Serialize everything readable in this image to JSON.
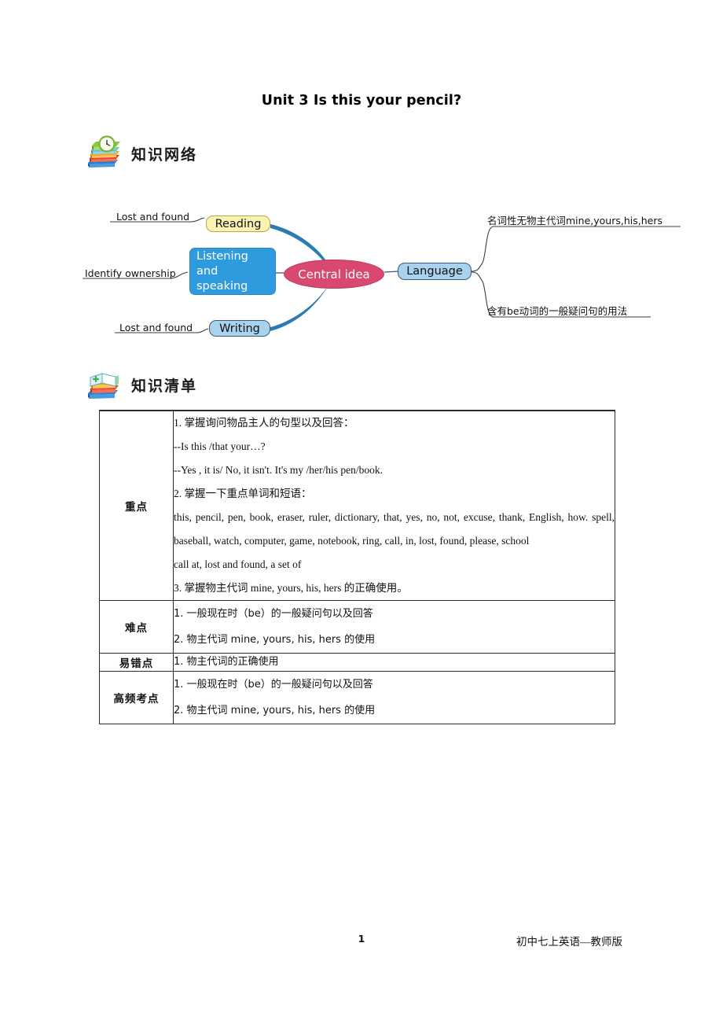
{
  "document": {
    "title": "Unit 3 Is this your pencil?"
  },
  "sections": {
    "network": {
      "icon": "books-clock-icon",
      "heading": "知识网络"
    },
    "checklist": {
      "icon": "books-open-icon",
      "heading": "知识清单"
    }
  },
  "mindmap": {
    "central": "Central idea",
    "nodes": {
      "reading": "Reading",
      "listening": "Listening\nand\nspeaking",
      "writing": "Writing",
      "language": "Language"
    },
    "leaves": {
      "reading_leaf": "Lost and found",
      "listening_leaf": "Identify ownership",
      "writing_leaf": "Lost and found",
      "language_leaf_1": "名词性无物主代词mine,yours,his,hers",
      "language_leaf_2": "含有be动词的一般疑问句的用法"
    },
    "colors": {
      "central_fill": "#d9486f",
      "reading_fill": "#fbf3b4",
      "listening_fill": "#2f9bdf",
      "light_blue_fill": "#a9d2ef",
      "branch_stroke": "#2b7cb0"
    }
  },
  "table": {
    "rows": [
      {
        "label": "重点",
        "lines": [
          "1. 掌握询问物品主人的句型以及回答：",
          "--Is this /that your…?",
          "--Yes , it is/ No, it isn't. It's my /her/his pen/book.",
          "2. 掌握一下重点单词和短语：",
          "this, pencil, pen, book, eraser, ruler, dictionary, that, yes, no, not, excuse, thank, English, how. spell, baseball, watch, computer, game, notebook, ring, call, in, lost, found, please, school",
          "call at, lost and found, a set of",
          "3.   掌握物主代词 mine, yours, his, hers 的正确使用。"
        ]
      },
      {
        "label": "难点",
        "lines": [
          "1.   一般现在时（be）的一般疑问句以及回答",
          "2.   物主代词 mine, yours, his, hers 的使用"
        ]
      },
      {
        "label": "易错点",
        "lines": [
          "1.   物主代词的正确使用"
        ]
      },
      {
        "label": "高频考点",
        "lines": [
          "1.   一般现在时（be）的一般疑问句以及回答",
          "2.   物主代词 mine, yours, his, hers 的使用"
        ]
      }
    ]
  },
  "footer": {
    "page_number": "1",
    "note": "初中七上英语—教师版"
  }
}
